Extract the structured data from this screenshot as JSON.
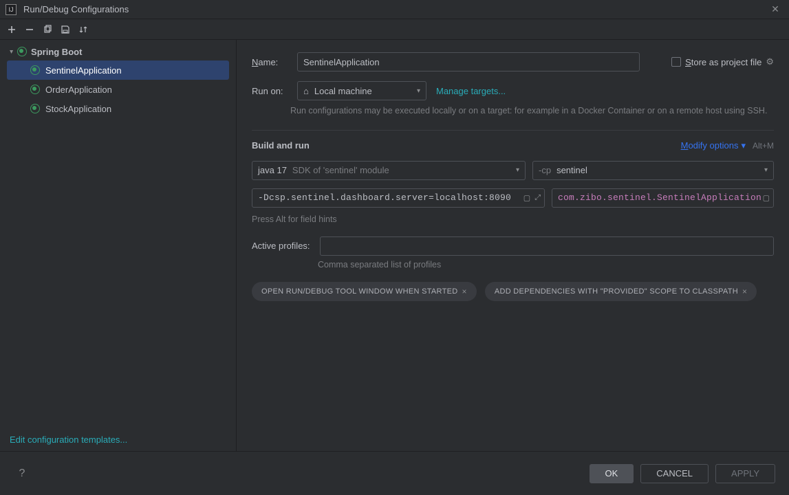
{
  "window": {
    "title": "Run/Debug Configurations"
  },
  "sidebar": {
    "group": "Spring Boot",
    "items": [
      {
        "label": "SentinelApplication",
        "selected": true
      },
      {
        "label": "OrderApplication",
        "selected": false
      },
      {
        "label": "StockApplication",
        "selected": false
      }
    ],
    "edit_templates": "Edit configuration templates..."
  },
  "form": {
    "name_label": "Name:",
    "name_value": "SentinelApplication",
    "store_label": "Store as project file",
    "runon_label": "Run on:",
    "runon_value": "Local machine",
    "manage_targets": "Manage targets...",
    "runon_hint": "Run configurations may be executed locally or on a target: for example in a Docker Container or on a remote host using SSH.",
    "buildrun_title": "Build and run",
    "modify_options": "Modify options",
    "modify_kbd": "Alt+M",
    "jdk_value": "java 17",
    "jdk_hint": "SDK of 'sentinel' module",
    "cp_prefix": "-cp",
    "cp_value": "sentinel",
    "vm_options": "-Dcsp.sentinel.dashboard.server=localhost:8090",
    "main_class": "com.zibo.sentinel.SentinelApplication",
    "field_hint": "Press Alt for field hints",
    "profiles_label": "Active profiles:",
    "profiles_value": "",
    "profiles_hint": "Comma separated list of profiles",
    "chips": [
      "OPEN RUN/DEBUG TOOL WINDOW WHEN STARTED",
      "ADD DEPENDENCIES WITH \"PROVIDED\" SCOPE TO CLASSPATH"
    ]
  },
  "buttons": {
    "ok": "OK",
    "cancel": "CANCEL",
    "apply": "APPLY"
  }
}
